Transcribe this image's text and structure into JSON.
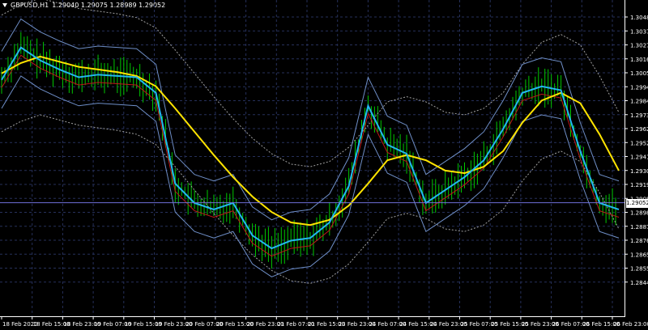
{
  "symbol": "GBPUSD,H1",
  "ohlc": "1.29040 1.29075 1.28989 1.29052",
  "current_price": "1.29052",
  "colors": {
    "background": "#000000",
    "grid": "#26305a",
    "candles": "#00c800",
    "ma_slow": "#ffe400",
    "ma_fast": "#22b8f0",
    "ma_red": "#c01818",
    "bands_outer": "#6f8fc8",
    "bands_dotted": "#a0a0a0",
    "price_line": "#6f6fd8"
  },
  "chart_data": {
    "type": "line",
    "y_ticks": [
      "1.30485",
      "1.30375",
      "1.30270",
      "1.30160",
      "1.30055",
      "1.29945",
      "1.29840",
      "1.29730",
      "1.29625",
      "1.29520",
      "1.29410",
      "1.29305",
      "1.29195",
      "1.29085",
      "1.28980",
      "1.28870",
      "1.28765",
      "1.28655",
      "1.28550",
      "1.28440"
    ],
    "x_ticks": [
      "18 Feb 2020",
      "18 Feb 15:00",
      "18 Feb 23:00",
      "19 Feb 07:00",
      "19 Feb 15:00",
      "19 Feb 23:00",
      "20 Feb 07:00",
      "20 Feb 15:00",
      "20 Feb 23:00",
      "21 Feb 07:00",
      "21 Feb 15:00",
      "23 Feb 23:00",
      "24 Feb 07:00",
      "24 Feb 15:00",
      "24 Feb 23:00",
      "25 Feb 07:00",
      "25 Feb 15:00",
      "25 Feb 23:00",
      "26 Feb 07:00",
      "26 Feb 15:00",
      "26 Feb 23:00"
    ],
    "ylim": [
      1.2839,
      1.3059
    ],
    "grid": true,
    "series": [
      {
        "name": "",
        "color": "#ffe400",
        "values": [
          1.3005,
          1.3013,
          1.3018,
          1.3014,
          1.301,
          1.3008,
          1.3006,
          1.3003,
          1.2995,
          1.2978,
          1.296,
          1.2942,
          1.2925,
          1.291,
          1.2898,
          1.289,
          1.2888,
          1.2892,
          1.2903,
          1.292,
          1.2938,
          1.2942,
          1.2938,
          1.293,
          1.2928,
          1.2933,
          1.2945,
          1.2967,
          1.2984,
          1.299,
          1.2982,
          1.2958,
          1.293
        ]
      },
      {
        "name": "",
        "color": "#22b8f0",
        "values": [
          1.3,
          1.3025,
          1.3015,
          1.3008,
          1.3002,
          1.3004,
          1.3003,
          1.3002,
          1.299,
          1.292,
          1.2905,
          1.29,
          1.2905,
          1.288,
          1.287,
          1.2876,
          1.2878,
          1.289,
          1.2918,
          1.298,
          1.295,
          1.2943,
          1.2905,
          1.2915,
          1.2925,
          1.2938,
          1.2962,
          1.299,
          1.2995,
          1.2992,
          1.2945,
          1.2905,
          1.29
        ]
      }
    ]
  }
}
